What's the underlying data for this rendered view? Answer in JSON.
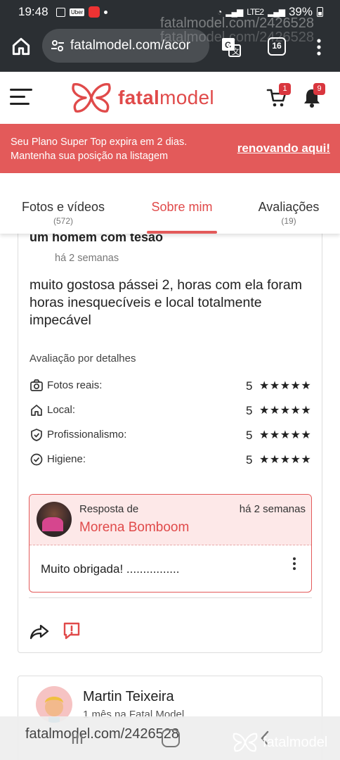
{
  "status_bar": {
    "time": "19:48",
    "uber": "Uber",
    "battery": "39%"
  },
  "browser": {
    "url": "fatalmodel.com/acor",
    "tabs_count": "16",
    "watermark": "fatalmodel.com/2426528"
  },
  "header": {
    "brand_bold": "fatal",
    "brand_rest": "model",
    "cart_badge": "1",
    "notification_badge": "9"
  },
  "promo": {
    "line1": "Seu Plano Super Top expira em 2 dias.",
    "line2": "Mantenha sua posição na listagem",
    "cta": "renovando aqui!"
  },
  "tabs": [
    {
      "label": "Fotos e vídeos",
      "count": "(572)"
    },
    {
      "label": "Sobre mim",
      "count": ""
    },
    {
      "label": "Avaliações",
      "count": "(19)"
    }
  ],
  "review": {
    "title": "um homem com tesão",
    "date": "há 2 semanas",
    "text": "muito gostosa pássei 2, horas com ela foram horas inesquecíveis e local totalmente impecável",
    "detail_heading": "Avaliação por detalhes",
    "ratings": [
      {
        "label": "Fotos reais:",
        "value": "5",
        "stars": 5,
        "icon": "camera-icon"
      },
      {
        "label": "Local:",
        "value": "5",
        "stars": 5,
        "icon": "home-icon"
      },
      {
        "label": "Profissionalismo:",
        "value": "5",
        "stars": 5,
        "icon": "shield-check-icon"
      },
      {
        "label": "Higiene:",
        "value": "5",
        "stars": 5,
        "icon": "check-circle-icon"
      }
    ],
    "reply": {
      "label": "Resposta de",
      "date": "há 2 semanas",
      "name": "Morena Bomboom",
      "text": "Muito obrigada! ................"
    }
  },
  "next_review": {
    "name": "Martin Teixeira",
    "subtitle": "1 mês na Fatal Model"
  },
  "nav_watermark": {
    "url": "fatalmodel.com/2426528",
    "brand": "fatalmodel"
  },
  "colors": {
    "accent": "#e04a4a",
    "promo_bg": "#e35a5a",
    "reply_bg": "#fde8e8",
    "chrome_bg": "#2b2f33"
  }
}
